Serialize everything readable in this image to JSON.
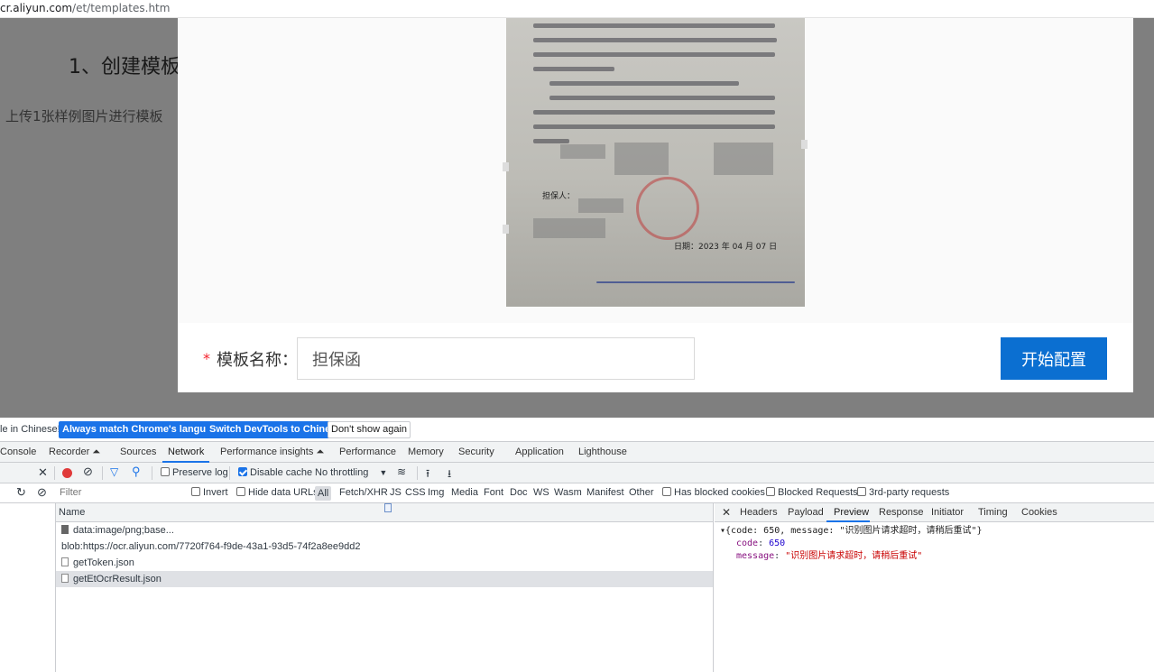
{
  "address_bar": {
    "host": "cr.aliyun.com",
    "path": "/et/templates.htm"
  },
  "page": {
    "heading": "1、创建模板",
    "subtext": "上传1张样例图片进行模板"
  },
  "modal": {
    "document_preview": {
      "guarantor_label": "担保人：",
      "date_text": "日期：2023 年 04 月 07 日"
    },
    "form": {
      "required_mark": "*",
      "label": "模板名称：",
      "name_value": "担保函",
      "start_button": "开始配置"
    }
  },
  "devtools": {
    "infobar": {
      "message": "le in Chinese!",
      "btn_match": "Always match Chrome's language",
      "btn_switch": "Switch DevTools to Chinese",
      "btn_dismiss": "Don't show again"
    },
    "tabs": [
      "Console",
      "Recorder ⏶",
      "Sources",
      "Network",
      "Performance insights ⏶",
      "Performance",
      "Memory",
      "Security",
      "Application",
      "Lighthouse"
    ],
    "toolbar": {
      "preserve_log": "Preserve log",
      "disable_cache": "Disable cache",
      "throttling": "No throttling"
    },
    "filter": {
      "placeholder": "Filter",
      "invert": "Invert",
      "hide_data_urls": "Hide data URLs",
      "types": [
        "All",
        "Fetch/XHR",
        "JS",
        "CSS",
        "Img",
        "Media",
        "Font",
        "Doc",
        "WS",
        "Wasm",
        "Manifest",
        "Other"
      ],
      "blocked_cookies": "Has blocked cookies",
      "blocked_requests": "Blocked Requests",
      "third_party": "3rd-party requests"
    },
    "requests": {
      "column_name": "Name",
      "rows": [
        "data:image/png;base...",
        "blob:https://ocr.aliyun.com/7720f764-f9de-43a1-93d5-74f2a8ee9dd2",
        "getToken.json",
        "getEtOcrResult.json"
      ]
    },
    "detail": {
      "tabs": [
        "Headers",
        "Payload",
        "Preview",
        "Response",
        "Initiator",
        "Timing",
        "Cookies"
      ],
      "summary": "{code: 650, message: \"识别图片请求超时，请稍后重试\"}",
      "code_key": "code",
      "code_value": "650",
      "message_key": "message",
      "message_value": "\"识别图片请求超时，请稍后重试\""
    }
  }
}
